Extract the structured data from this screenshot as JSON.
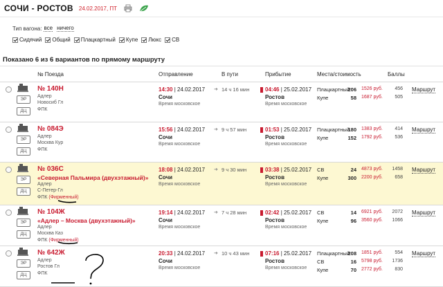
{
  "header": {
    "route": "СОЧИ - РОСТОВ",
    "date": "24.02.2017, ПТ",
    "print_icon": "printer-icon",
    "leaf_icon": "leaf-icon"
  },
  "filters": {
    "wagon_type_label": "Тип вагона:",
    "all_label": "все",
    "nothing_label": "ничего",
    "options": [
      {
        "label": "Сидячий",
        "checked": true
      },
      {
        "label": "Общий",
        "checked": true
      },
      {
        "label": "Плацкартный",
        "checked": true
      },
      {
        "label": "Купе",
        "checked": true
      },
      {
        "label": "Люкс",
        "checked": true
      },
      {
        "label": "СВ",
        "checked": true
      }
    ]
  },
  "summary": "Показано 6 из 6 вариантов по прямому маршруту",
  "columns": {
    "train": "№ Поезда",
    "departure": "Отправление",
    "duration": "В пути",
    "arrival": "Прибытие",
    "seats": "Места/стоимость",
    "points": "Баллы"
  },
  "badges": {
    "er": "ЭР",
    "dts": "ДЦ"
  },
  "trains": [
    {
      "number": "№ 140Н",
      "name": "",
      "from": "Адлер",
      "to": "Новосиб Гл",
      "carrier": "ФПК",
      "brand": "",
      "dep_time": "14:30",
      "dep_date": "24.02.2017",
      "dep_city": "Сочи",
      "tz": "Время московское",
      "duration": "14 ч 16 мин",
      "arr_time": "04:46",
      "arr_date": "25.02.2017",
      "arr_city": "Ростов",
      "seats": [
        {
          "cls": "Плацкартный",
          "count": "206",
          "price": "1526 руб.",
          "points": "456"
        },
        {
          "cls": "Купе",
          "count": "58",
          "price": "1687 руб.",
          "points": "505"
        }
      ],
      "route": "Маршрут"
    },
    {
      "number": "№ 084Э",
      "name": "",
      "from": "Адлер",
      "to": "Москва Кур",
      "carrier": "ФПК",
      "brand": "",
      "dep_time": "15:56",
      "dep_date": "24.02.2017",
      "dep_city": "Сочи",
      "tz": "Время московское",
      "duration": "9 ч 57 мин",
      "arr_time": "01:53",
      "arr_date": "25.02.2017",
      "arr_city": "Ростов",
      "seats": [
        {
          "cls": "Плацкартный",
          "count": "180",
          "price": "1383 руб.",
          "points": "414"
        },
        {
          "cls": "Купе",
          "count": "152",
          "price": "1792 руб.",
          "points": "536"
        }
      ],
      "route": "Маршрут"
    },
    {
      "number": "№ 036С",
      "name": "«Северная Пальмира (двухэтажный)»",
      "from": "Адлер",
      "to": "С-Петер-Гл",
      "carrier": "ФПК",
      "brand": "(Фирменный)",
      "dep_time": "18:08",
      "dep_date": "24.02.2017",
      "dep_city": "Сочи",
      "tz": "Время московское",
      "duration": "9 ч 30 мин",
      "arr_time": "03:38",
      "arr_date": "25.02.2017",
      "arr_city": "Ростов",
      "seats": [
        {
          "cls": "СВ",
          "count": "24",
          "price": "4873 руб.",
          "points": "1458"
        },
        {
          "cls": "Купе",
          "count": "300",
          "price": "2200 руб.",
          "points": "658"
        }
      ],
      "route": "Маршрут"
    },
    {
      "number": "№ 104Ж",
      "name": "«Адлер – Москва (двухэтажный)»",
      "from": "Адлер",
      "to": "Москва Каз",
      "carrier": "ФПК",
      "brand": "(Фирменный)",
      "dep_time": "19:14",
      "dep_date": "24.02.2017",
      "dep_city": "Сочи",
      "tz": "Время московское",
      "duration": "7 ч 28 мин",
      "arr_time": "02:42",
      "arr_date": "25.02.2017",
      "arr_city": "Ростов",
      "seats": [
        {
          "cls": "СВ",
          "count": "14",
          "price": "6921 руб.",
          "points": "2072"
        },
        {
          "cls": "Купе",
          "count": "96",
          "price": "3560 руб.",
          "points": "1066"
        }
      ],
      "route": "Маршрут"
    },
    {
      "number": "№ 642Ж",
      "name": "",
      "from": "Адлер",
      "to": "Ростов Гл",
      "carrier": "ФПК",
      "brand": "",
      "dep_time": "20:33",
      "dep_date": "24.02.2017",
      "dep_city": "Сочи",
      "tz": "Время московское",
      "duration": "10 ч 43 мин",
      "arr_time": "07:16",
      "arr_date": "25.02.2017",
      "arr_city": "Ростов",
      "seats": [
        {
          "cls": "Плацкартный",
          "count": "208",
          "price": "1851 руб.",
          "points": "554"
        },
        {
          "cls": "СВ",
          "count": "16",
          "price": "5798 руб.",
          "points": "1736"
        },
        {
          "cls": "Купе",
          "count": "70",
          "price": "2772 руб.",
          "points": "830"
        }
      ],
      "route": "Маршрут"
    }
  ]
}
